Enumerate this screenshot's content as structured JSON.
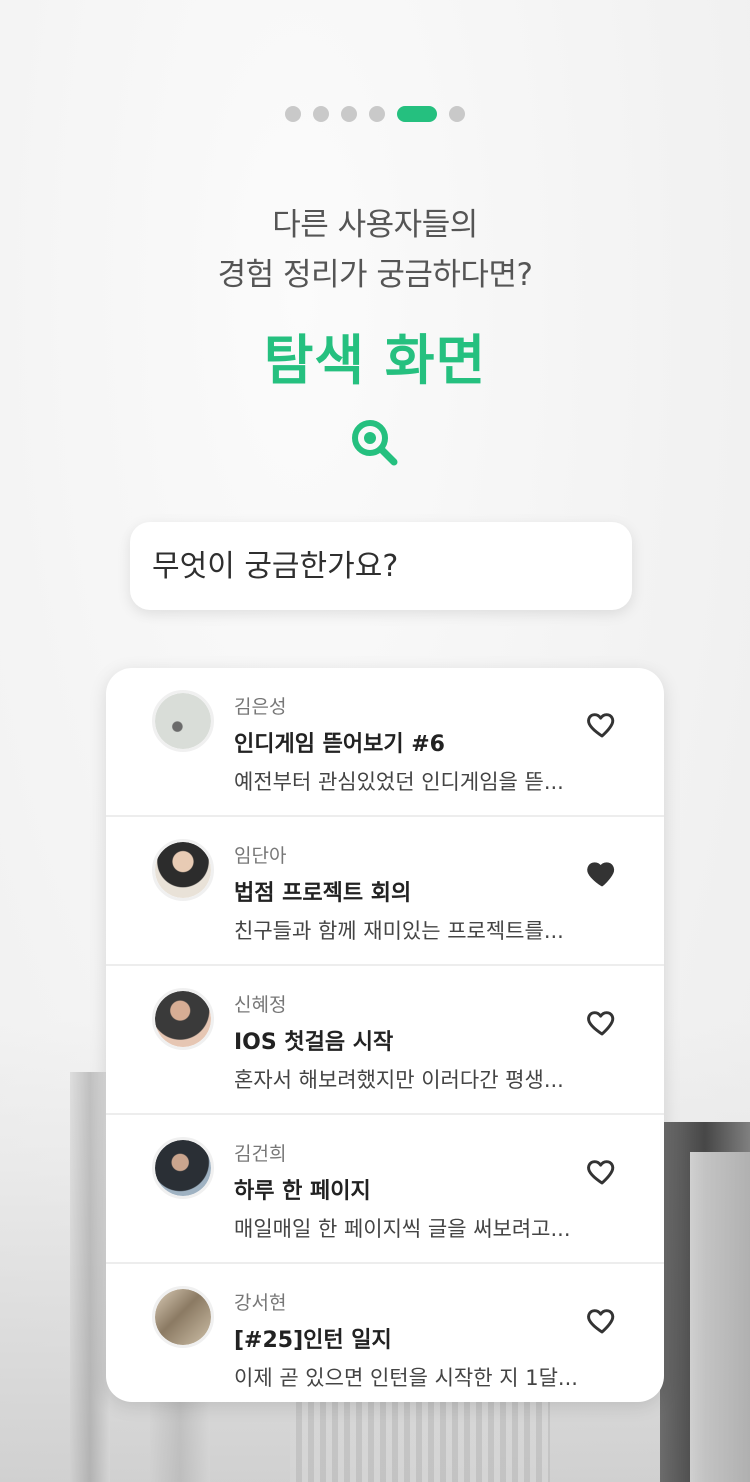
{
  "pagination": {
    "total": 6,
    "active_index": 4
  },
  "header": {
    "subtitle_line1": "다른 사용자들의",
    "subtitle_line2": "경험 정리가 궁금하다면?",
    "title": "탐색 화면"
  },
  "search": {
    "placeholder": "무엇이 궁금한가요?"
  },
  "colors": {
    "accent": "#25c07f"
  },
  "posts": [
    {
      "author": "김은성",
      "title": "인디게임 뜯어보기 #6",
      "snippet": "예전부터 관심있었던 인디게임을 뜯...",
      "liked": false,
      "avatar_color": "#cfd3cf"
    },
    {
      "author": "임단아",
      "title": "법점 프로젝트 회의",
      "snippet": "친구들과 함께 재미있는 프로젝트를...",
      "liked": true,
      "avatar_color": "#d7b99f"
    },
    {
      "author": "신혜정",
      "title": "IOS 첫걸음 시작",
      "snippet": "혼자서 해보려했지만 이러다간 평생...",
      "liked": false,
      "avatar_color": "#c59c83"
    },
    {
      "author": "김건희",
      "title": "하루 한 페이지",
      "snippet": "매일매일 한 페이지씩 글을 써보려고...",
      "liked": false,
      "avatar_color": "#7e8a95"
    },
    {
      "author": "강서현",
      "title": "[#25]인턴 일지",
      "snippet": "이제 곧 있으면 인턴을 시작한 지 1달...",
      "liked": false,
      "avatar_color": "#b5a48c"
    }
  ]
}
